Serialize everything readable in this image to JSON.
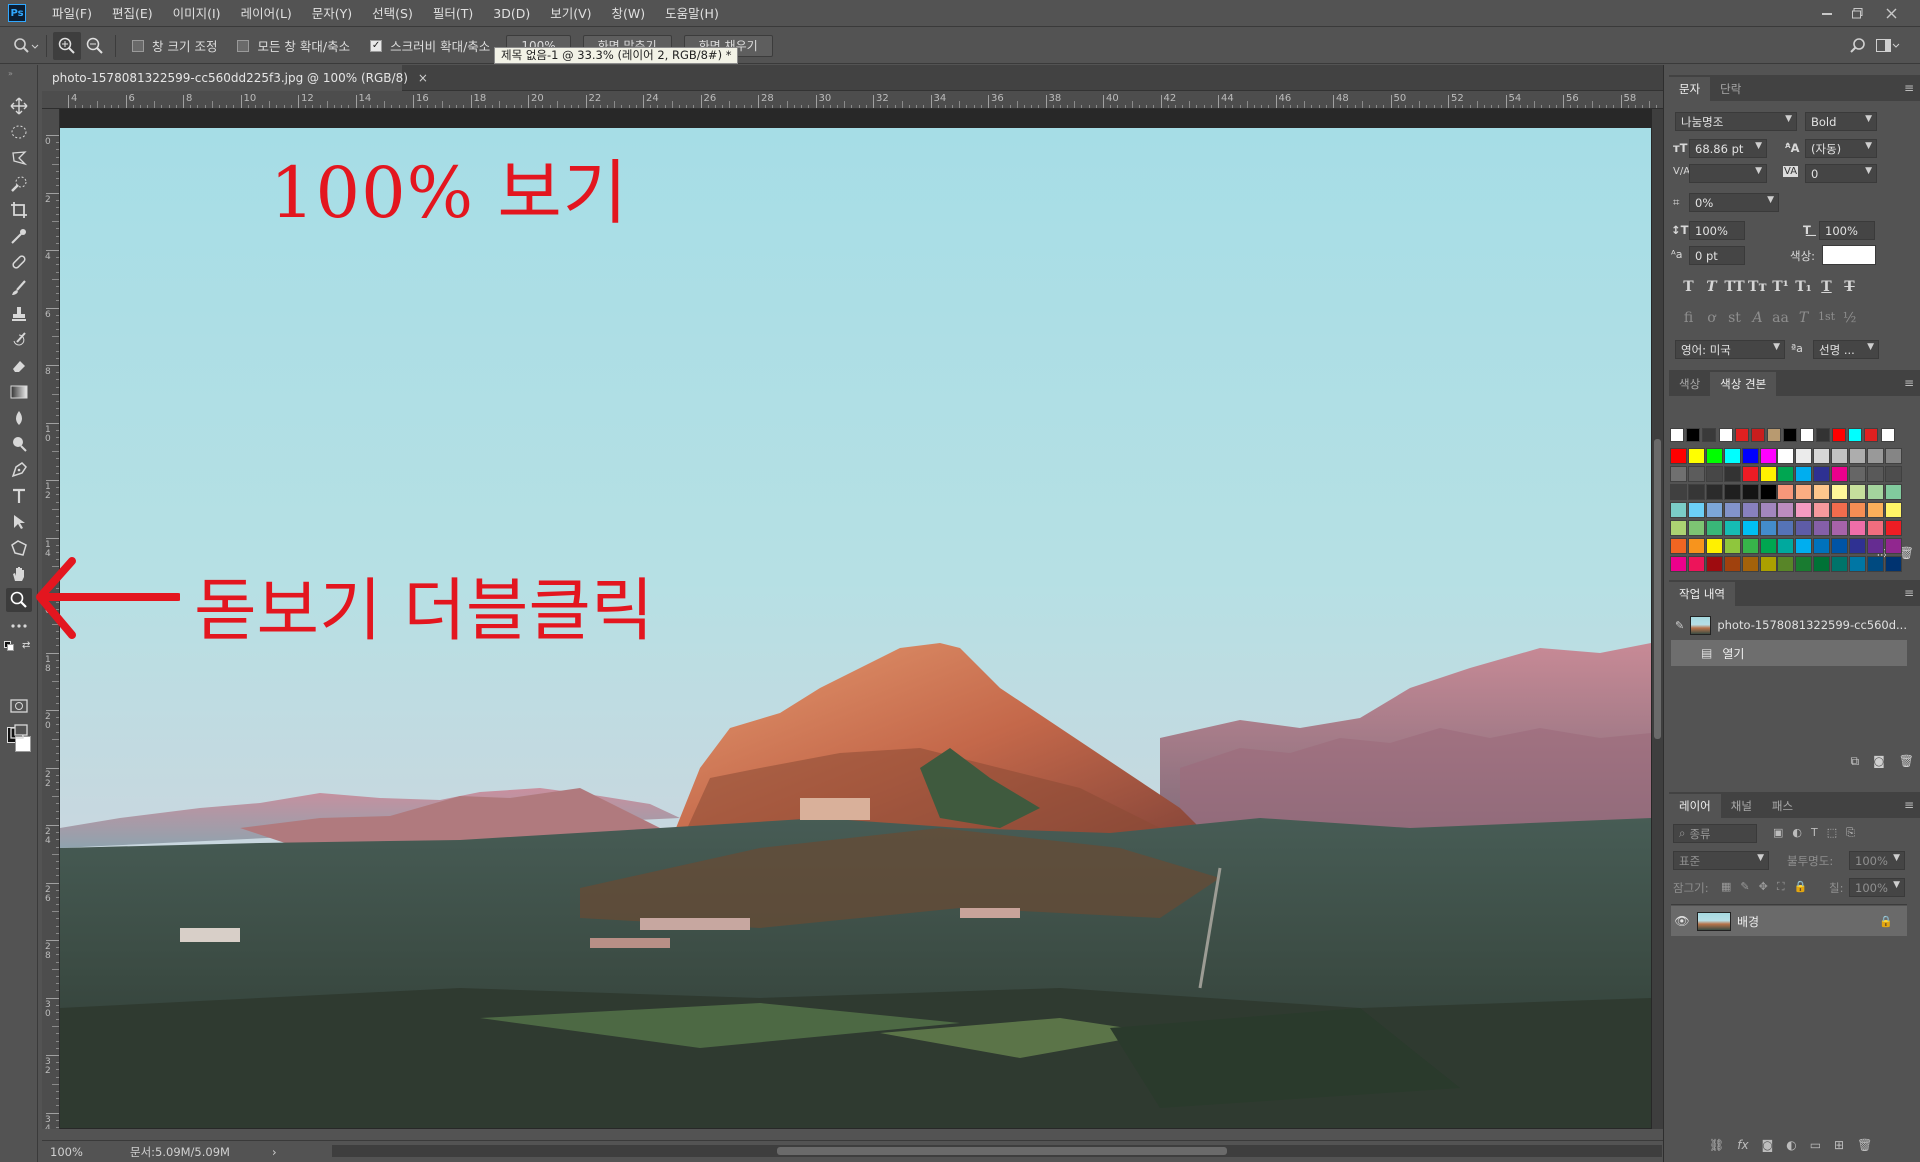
{
  "app": {
    "logo": "Ps"
  },
  "menu": [
    "파일(F)",
    "편집(E)",
    "이미지(I)",
    "레이어(L)",
    "문자(Y)",
    "선택(S)",
    "필터(T)",
    "3D(D)",
    "보기(V)",
    "창(W)",
    "도움말(H)"
  ],
  "options": {
    "checkbox_resize": "창 크기 조정",
    "checkbox_all_windows": "모든 창 확대/축소",
    "checkbox_scrubby": "스크러비 확대/축소",
    "scrubby_checked": true,
    "btn_100": "100%",
    "btn_fit": "화면 맞추기",
    "btn_fill": "화면 채우기",
    "tooltip": "제목 없음-1 @ 33.3% (레이어 2, RGB/8#) *"
  },
  "document": {
    "tab_title": "photo-1578081322599-cc560dd225f3.jpg @ 100% (RGB/8)",
    "tab_close": "×"
  },
  "ruler": {
    "top": [
      "4",
      "6",
      "8",
      "10",
      "12",
      "14",
      "16",
      "18",
      "20",
      "22",
      "24",
      "26",
      "28",
      "30",
      "32",
      "34",
      "36",
      "38",
      "40",
      "42",
      "44",
      "46",
      "48",
      "50",
      "52",
      "54",
      "56",
      "58"
    ],
    "left": [
      "0",
      "2",
      "4",
      "6",
      "8",
      "1 0",
      "1 2",
      "1 4",
      "1 6",
      "1 8",
      "2 0",
      "2 2",
      "2 4",
      "2 6",
      "2 8",
      "3 0",
      "3 2",
      "3 4"
    ]
  },
  "annotations": {
    "title": "100% 보기",
    "arrow_text": "돋보기 더블클릭",
    "color": "#e3161f"
  },
  "status": {
    "zoom": "100%",
    "doc": "문서:5.09M/5.09M",
    "arrow": "›"
  },
  "character_panel": {
    "tabs": [
      "문자",
      "단락"
    ],
    "font_family": "나눔명조",
    "font_style": "Bold",
    "font_size": "68.86 pt",
    "leading": "(자동)",
    "kerning_label": "V/A",
    "kerning": "",
    "tracking_label": "VA",
    "tracking": "0",
    "tsume": "0%",
    "vscale": "100%",
    "hscale": "100%",
    "baseline": "0 pt",
    "color_label": "색상:",
    "text_color": "#ffffff",
    "style_glyphs": [
      "T",
      "T",
      "TT",
      "Tт",
      "T¹",
      "T₁",
      "T",
      "T"
    ],
    "opentype_glyphs": [
      "fi",
      "ơ",
      "st",
      "A",
      "aa",
      "T",
      "1st",
      "½"
    ],
    "language": "영어: 미국",
    "aa_label": "ªa",
    "antialias": "선명 ..."
  },
  "swatches_panel": {
    "tabs": [
      "색상",
      "색상 견본"
    ],
    "recent": [
      "#ffffff",
      "#000000",
      "#3a3a3a",
      "#ffffff",
      "#e02020",
      "#c81e1e",
      "#b89a70",
      "#000000",
      "#ffffff",
      "#333333",
      "#ff0000",
      "#00ffff",
      "#e02020",
      "#ffffff"
    ],
    "grid": [
      [
        "#ff0000",
        "#ffff00",
        "#00ff00",
        "#00ffff",
        "#0000ff",
        "#ff00ff",
        "#ffffff",
        "#ebebeb",
        "#d6d6d6",
        "#c2c2c2",
        "#adadad",
        "#999999",
        "#858585"
      ],
      [
        "#707070",
        "#5c5c5c",
        "#474747",
        "#333333",
        "#ed1c24",
        "#fff200",
        "#00a651",
        "#00aeef",
        "#2e3192",
        "#ec008c",
        "#666666",
        "#595959",
        "#4d4d4d"
      ],
      [
        "#404040",
        "#363636",
        "#2b2b2b",
        "#1f1f1f",
        "#141414",
        "#000000",
        "#f7977a",
        "#fbad82",
        "#fdc68c",
        "#fff799",
        "#c6df9c",
        "#a4d49d",
        "#81ca9d"
      ],
      [
        "#7bcdc8",
        "#6ccff7",
        "#7ca6d8",
        "#8293ca",
        "#8881be",
        "#a286bd",
        "#bc8cbf",
        "#f49bc1",
        "#f5999d",
        "#f16c4d",
        "#f68e54",
        "#fbaf5a",
        "#fff467"
      ],
      [
        "#acd372",
        "#7dc473",
        "#39b778",
        "#16bcb4",
        "#00bff3",
        "#438ccb",
        "#5573b7",
        "#5e5ca7",
        "#855fa8",
        "#a763a9",
        "#ef6ea8",
        "#f16d7e",
        "#ee1d24"
      ],
      [
        "#f16522",
        "#f7941d",
        "#fff100",
        "#8fc63d",
        "#37b44a",
        "#00a650",
        "#00a99e",
        "#00aeef",
        "#0072bc",
        "#0054a5",
        "#2f3192",
        "#652c91",
        "#91278f"
      ],
      [
        "#ec008c",
        "#ed145a",
        "#9e0b0f",
        "#a0410d",
        "#a3620a",
        "#aba000",
        "#588528",
        "#197b30",
        "#007236",
        "#00736a",
        "#0076a4",
        "#004a80",
        "#003370"
      ]
    ]
  },
  "history_panel": {
    "tab": "작업 내역",
    "snapshot": "photo-1578081322599-cc560d...",
    "open_step": "열기"
  },
  "layers_panel": {
    "tabs": [
      "레이어",
      "채널",
      "패스"
    ],
    "kind_placeholder": "종류",
    "blend_mode": "표준",
    "opacity_label": "불투명도:",
    "opacity": "100%",
    "lock_label": "잠그기:",
    "fill_label": "칠:",
    "fill": "100%",
    "layer_name": "배경"
  }
}
